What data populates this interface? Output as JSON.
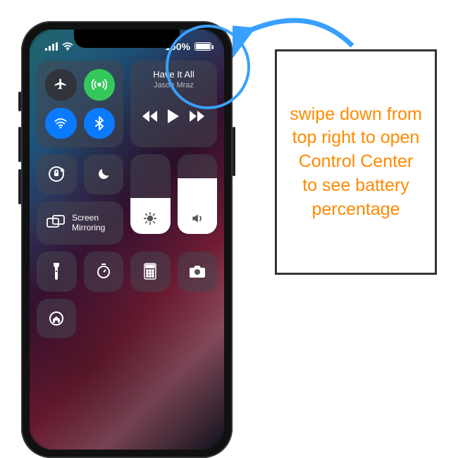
{
  "status": {
    "battery_text": "100%",
    "battery_level": 1.0
  },
  "connectivity": {
    "airplane": "airplane-icon",
    "cellular": "cellular-icon",
    "wifi": "wifi-icon",
    "bluetooth": "bluetooth-icon"
  },
  "music": {
    "title": "Have It All",
    "artist": "Jason Mraz"
  },
  "mirror": {
    "label": "Screen\nMirroring"
  },
  "brightness": {
    "level": 0.45
  },
  "volume": {
    "level": 0.7
  },
  "annotation": {
    "text": "swipe down from top right to open Control Center to see battery percentage"
  },
  "colors": {
    "accent_blue": "#0a7bff",
    "accent_green": "#34c759",
    "note_text": "#ff8a00",
    "circle": "#38a0ff"
  }
}
